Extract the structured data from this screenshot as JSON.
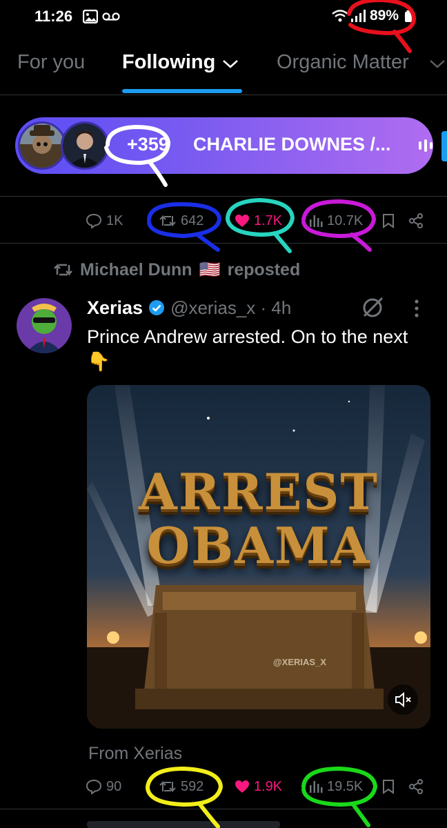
{
  "status_bar": {
    "time": "11:26",
    "battery": "89%"
  },
  "tabs": [
    {
      "label": "For you"
    },
    {
      "label": "Following"
    },
    {
      "label": "Organic Matter"
    }
  ],
  "space": {
    "listener_count": "+359",
    "title": "CHARLIE DOWNES /..."
  },
  "first_post_actions": {
    "replies": "1K",
    "reposts": "642",
    "likes": "1.7K",
    "views": "10.7K"
  },
  "repost_banner": {
    "name": "Michael Dunn",
    "flag": "🇺🇸",
    "suffix": "reposted"
  },
  "tweet": {
    "display_name": "Xerias",
    "handle": "@xerias_x · 4h",
    "text": "Prince Andrew arrested. On to the next 👇",
    "media": {
      "line1": "ARREST",
      "line2": "OBAMA",
      "watermark": "@XERIAS_X"
    },
    "from_label": "From Xerias"
  },
  "second_post_actions": {
    "replies": "90",
    "reposts": "592",
    "likes": "1.9K",
    "views": "19.5K"
  },
  "colors": {
    "accent": "#1d9bf0",
    "like": "#f91880",
    "muted": "#71767b",
    "annotation_red": "#e8101c",
    "annotation_white": "#ffffff",
    "annotation_blue": "#1a2ee8",
    "annotation_teal": "#27d4c0",
    "annotation_magenta": "#c81ad8",
    "annotation_yellow": "#f2ee1a",
    "annotation_green": "#1ad81a"
  }
}
